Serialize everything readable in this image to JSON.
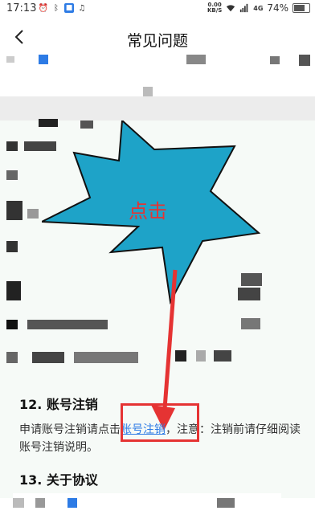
{
  "status_bar": {
    "time": "17:13",
    "speed_value": "0.00",
    "speed_unit": "KB/S",
    "network": "4G",
    "battery": "74%",
    "battery_level": 0.74
  },
  "header": {
    "title": "常见问题"
  },
  "annotation": {
    "burst_label": "点击",
    "accent_red": "#e53333",
    "burst_fill": "#1ea3c8"
  },
  "faq": {
    "item12": {
      "title": "12. 账号注销",
      "body_prefix": "申请账号注销请点击",
      "link_text": "账号注销",
      "body_suffix": "，注意：注销前请仔细阅读账号注销说明。"
    },
    "item13": {
      "title": "13. 关于协议"
    }
  },
  "colors": {
    "link": "#2d7be5",
    "divider": "#ececec",
    "content_bg": "#f6faf7"
  }
}
